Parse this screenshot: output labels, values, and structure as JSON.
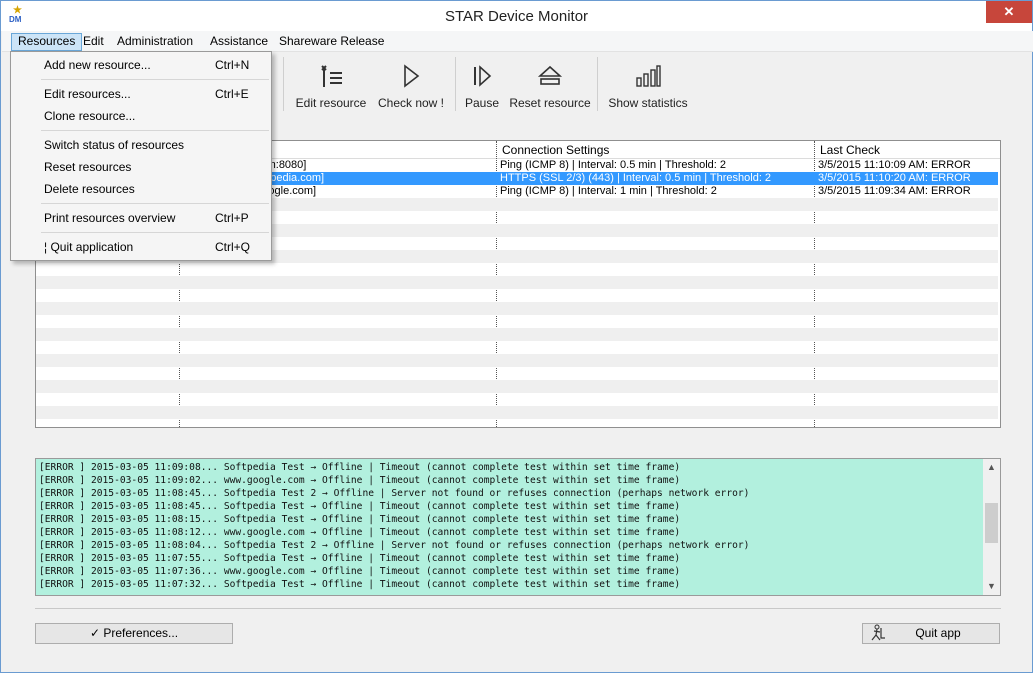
{
  "window": {
    "title": "STAR Device Monitor",
    "icon_text": "DM",
    "close_label": "✕"
  },
  "menubar": {
    "items": [
      "Resources",
      "Edit",
      "Administration",
      "Assistance",
      "Shareware Release"
    ]
  },
  "toolbar": {
    "partial_label": "e",
    "buttons": [
      {
        "label": "Edit resource",
        "icon": "wrench-list-icon"
      },
      {
        "label": "Check now !",
        "icon": "play-icon"
      },
      {
        "label": "Pause",
        "icon": "pause-icon"
      },
      {
        "label": "Reset resource",
        "icon": "reset-icon"
      },
      {
        "label": "Show statistics",
        "icon": "bar-chart-icon"
      }
    ]
  },
  "dropdown": {
    "items": [
      {
        "label": "Add new resource...",
        "shortcut": "Ctrl+N"
      },
      {
        "label": "Edit resources...",
        "shortcut": "Ctrl+E"
      },
      {
        "label": "Clone resource...",
        "shortcut": ""
      },
      {
        "label": "Switch status of resources",
        "shortcut": ""
      },
      {
        "label": "Reset resources",
        "shortcut": ""
      },
      {
        "label": "Delete resources",
        "shortcut": ""
      },
      {
        "label": "Print resources overview",
        "shortcut": "Ctrl+P"
      },
      {
        "label": "¦ Quit application",
        "shortcut": "Ctrl+Q"
      }
    ]
  },
  "grid": {
    "columns": [
      "Connection Settings",
      "Last Check"
    ],
    "rows": [
      {
        "target": "www.softpedia.com:8080]",
        "settings": "Ping (ICMP 8) | Interval: 0.5 min | Threshold: 2",
        "last": "3/5/2015 11:10:09 AM: ERROR",
        "selected": false
      },
      {
        "target": "2 [https://www.softpedia.com]",
        "settings": "HTTPS (SSL 2/3) (443) | Interval: 0.5 min | Threshold: 2",
        "last": "3/5/2015 11:10:20 AM: ERROR",
        "selected": true
      },
      {
        "target": "om [http://www.google.com]",
        "settings": "Ping (ICMP 8) | Interval: 1 min | Threshold: 2",
        "last": "3/5/2015 11:09:34 AM: ERROR",
        "selected": false
      }
    ]
  },
  "log": {
    "lines": [
      "[ERROR ] 2015-03-05 11:09:08... Softpedia Test → Offline | Timeout (cannot complete test within set time frame)",
      "[ERROR ] 2015-03-05 11:09:02... www.google.com → Offline | Timeout (cannot complete test within set time frame)",
      "[ERROR ] 2015-03-05 11:08:45... Softpedia Test 2 → Offline | Server not found or refuses connection (perhaps network error)",
      "[ERROR ] 2015-03-05 11:08:45... Softpedia Test → Offline | Timeout (cannot complete test within set time frame)",
      "[ERROR ] 2015-03-05 11:08:15... Softpedia Test → Offline | Timeout (cannot complete test within set time frame)",
      "[ERROR ] 2015-03-05 11:08:12... www.google.com → Offline | Timeout (cannot complete test within set time frame)",
      "[ERROR ] 2015-03-05 11:08:04... Softpedia Test 2 → Offline | Server not found or refuses connection (perhaps network error)",
      "[ERROR ] 2015-03-05 11:07:55... Softpedia Test → Offline | Timeout (cannot complete test within set time frame)",
      "[ERROR ] 2015-03-05 11:07:36... www.google.com → Offline | Timeout (cannot complete test within set time frame)",
      "[ERROR ] 2015-03-05 11:07:32... Softpedia Test → Offline | Timeout (cannot complete test within set time frame)"
    ]
  },
  "footer": {
    "preferences_label": "✓ Preferences...",
    "quit_label": "Quit app"
  }
}
